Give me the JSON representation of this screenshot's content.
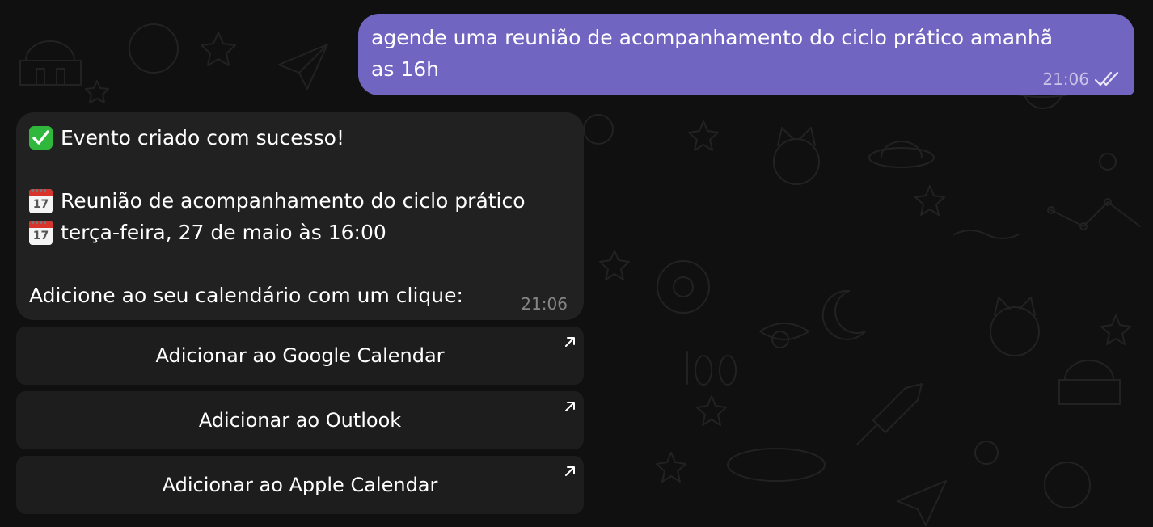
{
  "outgoing_message": {
    "text": "agende uma reunião de acompanhamento do ciclo prático amanhã\nas 16h",
    "time": "21:06",
    "status_icon": "double-check-icon"
  },
  "incoming_message": {
    "line_success": "Evento criado com sucesso!",
    "line_title": "Reunião de acompanhamento do ciclo prático",
    "line_date": "terça-feira, 27 de maio às 16:00",
    "line_prompt": "Adicione ao seu calendário com um clique:",
    "time": "21:06",
    "emoji_success": "check-mark-button-icon",
    "emoji_title": "calendar-icon",
    "emoji_date": "tear-off-calendar-icon",
    "calendar_day": "17"
  },
  "buttons": [
    {
      "label": "Adicionar ao Google Calendar",
      "icon": "external-link-arrow-icon"
    },
    {
      "label": "Adicionar ao Outlook",
      "icon": "external-link-arrow-icon"
    },
    {
      "label": "Adicionar ao Apple Calendar",
      "icon": "external-link-arrow-icon"
    }
  ],
  "colors": {
    "background": "#101010",
    "outgoing_bubble": "#7165c2",
    "incoming_bubble": "#212121",
    "button_bg": "#282828"
  }
}
